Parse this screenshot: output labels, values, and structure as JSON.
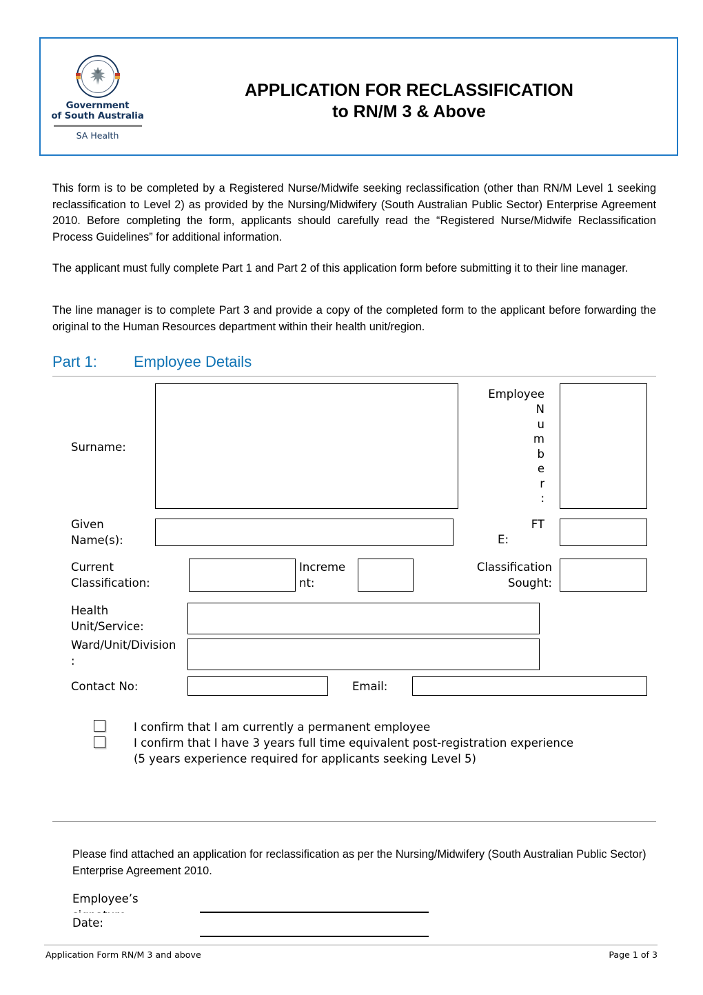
{
  "header": {
    "logo": {
      "crest_icon": "sa-government-crest-icon",
      "gov_line_1": "Government",
      "gov_line_2": "of South Australia",
      "sa_health": "SA Health"
    },
    "title_line_1": "APPLICATION FOR RECLASSIFICATION",
    "title_line_2": "to RN/M 3 & Above",
    "border_color": "#1f7ac7"
  },
  "intro": {
    "paragraph_1": "This form is to be completed by a Registered Nurse/Midwife seeking reclassification (other than RN/M Level 1 seeking reclassification to Level 2) as provided by the Nursing/Midwifery (South Australian Public Sector) Enterprise Agreement 2010.  Before completing the form, applicants should carefully read the “Registered Nurse/Midwife Reclassification Process Guidelines” for additional information.",
    "paragraph_2": "The applicant must fully complete Part 1 and Part 2 of this application form before submitting it to their line manager.",
    "paragraph_3": "The line manager is to complete Part 3 and provide a copy of the completed form to the applicant before forwarding the original to the Human Resources department within their health unit/region."
  },
  "part1": {
    "label": "Part 1:",
    "title": "Employee Details",
    "heading_color": "#1073b4",
    "fields": {
      "surname_label": "Surname:",
      "surname_value": "",
      "employee_number_label_line1": "Employee",
      "employee_number_label_stacked": [
        "N",
        "u",
        "m",
        "b",
        "e",
        "r",
        ":"
      ],
      "employee_number_value": "",
      "given_names_label": "Given\nName(s):",
      "given_names_value": "",
      "fte_label_line1": "FT",
      "fte_label_line2": "E:",
      "fte_value": "",
      "current_classification_label": "Current\nClassification:",
      "current_classification_value": "",
      "increment_label": "Increme\nnt:",
      "increment_value": "",
      "classification_sought_label": "Classification\nSought:",
      "classification_sought_value": "",
      "health_unit_label": "Health\nUnit/Service:",
      "health_unit_value": "",
      "ward_unit_division_label": "Ward/Unit/Division\n:",
      "ward_unit_division_value": "",
      "contact_no_label": "Contact No:",
      "contact_no_value": "",
      "email_label": "Email:",
      "email_value": ""
    },
    "checkboxes": [
      {
        "checked": false,
        "text": "I confirm that I am currently a permanent employee"
      },
      {
        "checked": false,
        "text": "I confirm that I have 3 years full time equivalent post-registration experience\n(5 years experience required for applicants seeking Level 5)"
      }
    ]
  },
  "closing": {
    "statement": "Please find attached an application for reclassification as per the Nursing/Midwifery (South Australian Public Sector) Enterprise Agreement 2010.",
    "signature_label_line1": "Employee’s",
    "signature_label_line2": "signature:",
    "signature_value": "",
    "date_label": "Date:",
    "date_value": ""
  },
  "footer": {
    "left": "Application Form RN/M 3 and above",
    "right": "Page 1 of 3"
  }
}
